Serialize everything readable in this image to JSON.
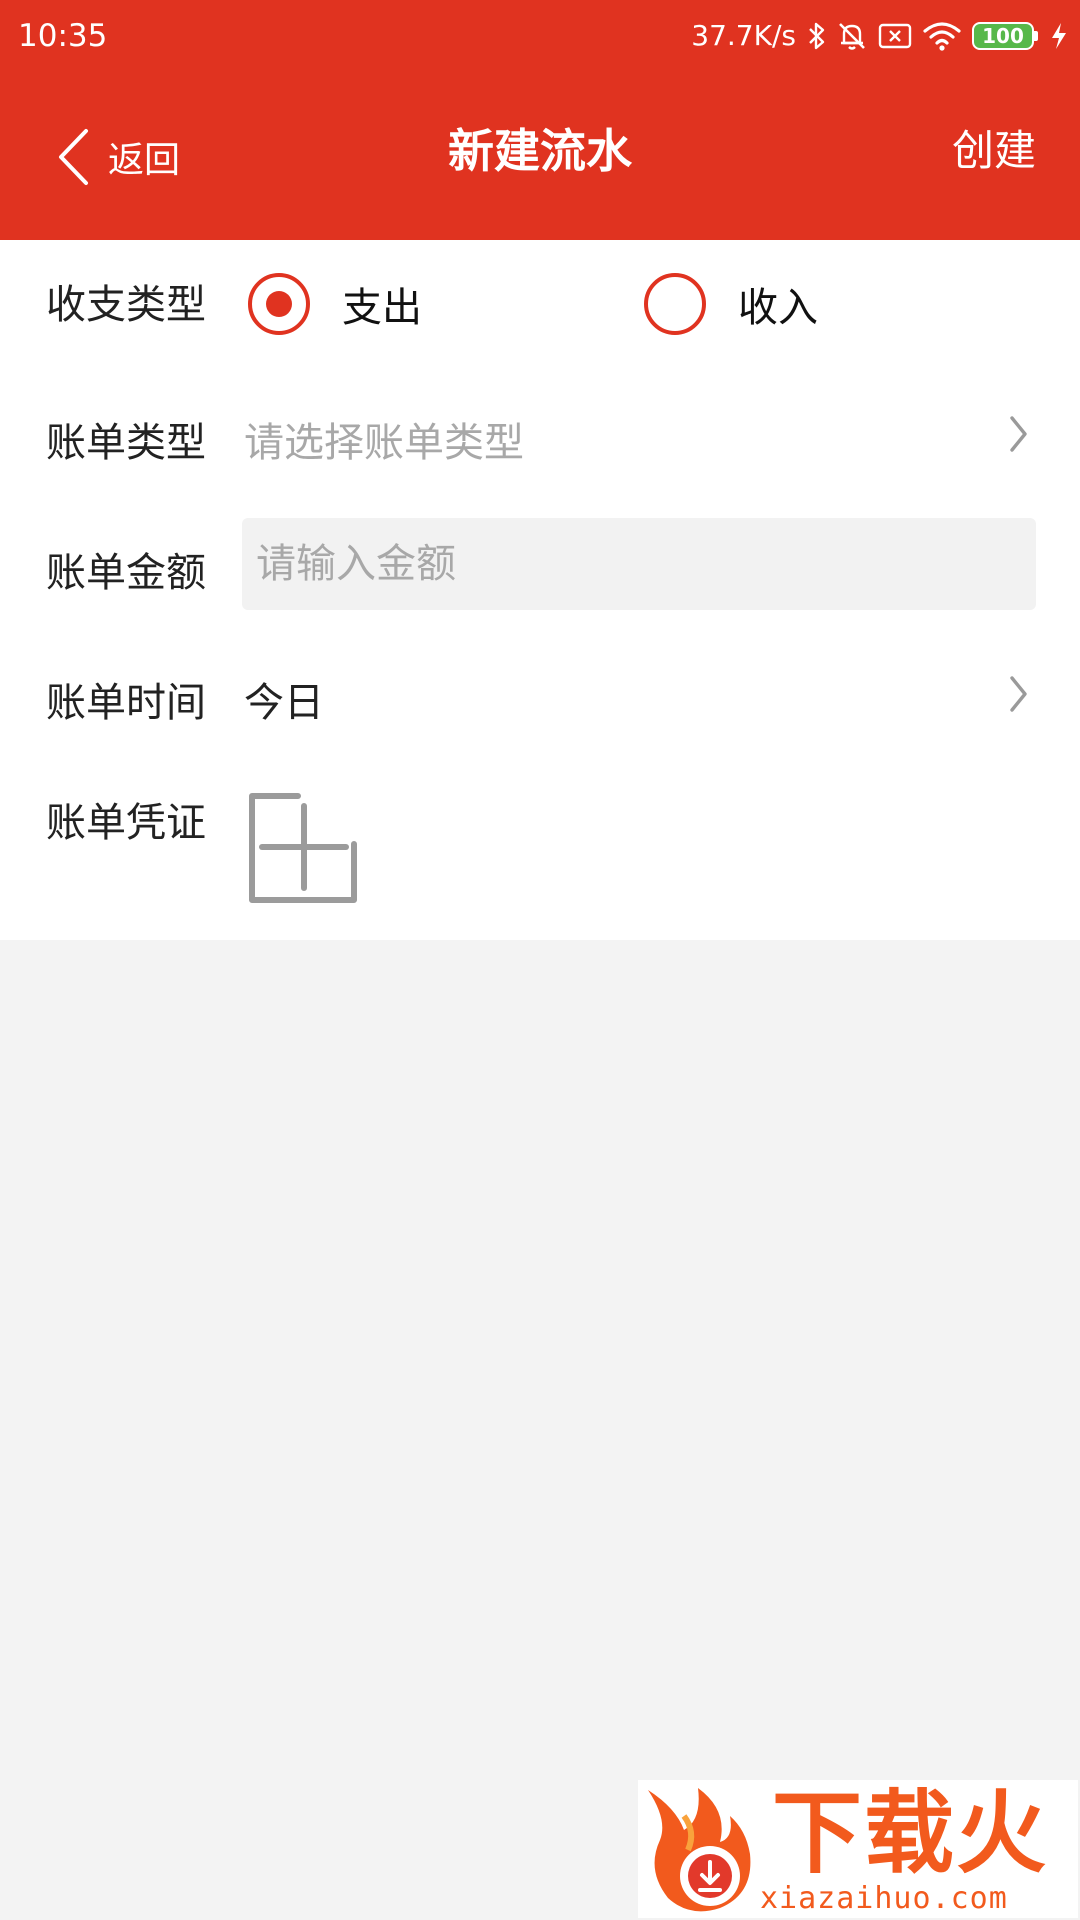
{
  "status_bar": {
    "time": "10:35",
    "net_speed": "37.7K/s",
    "battery_level": "100",
    "icons": [
      "bluetooth-icon",
      "mute-icon",
      "no-sim-icon",
      "wifi-icon",
      "battery-icon",
      "charging-icon"
    ]
  },
  "nav": {
    "back_label": "返回",
    "title": "新建流水",
    "action_label": "创建"
  },
  "form": {
    "type_row": {
      "label": "收支类型",
      "options": [
        {
          "label": "支出",
          "selected": true
        },
        {
          "label": "收入",
          "selected": false
        }
      ]
    },
    "bill_type": {
      "label": "账单类型",
      "placeholder": "请选择账单类型"
    },
    "amount": {
      "label": "账单金额",
      "value": "",
      "placeholder": "请输入金额"
    },
    "bill_time": {
      "label": "账单时间",
      "value": "今日"
    },
    "receipt": {
      "label": "账单凭证"
    }
  },
  "watermark": {
    "title": "下载火",
    "url": "xiazaihuo.com"
  },
  "colors": {
    "brand_red": "#e03320",
    "page_bg": "#f3f3f3",
    "placeholder": "#a8a8a8",
    "watermark_orange": "#f25a1d"
  }
}
